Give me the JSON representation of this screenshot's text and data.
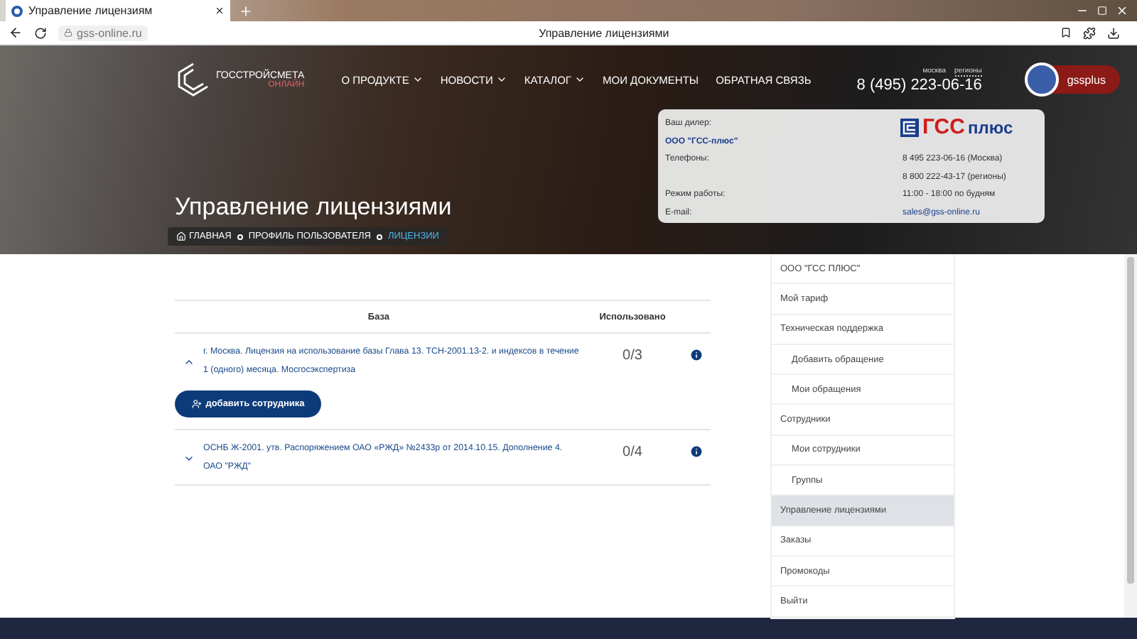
{
  "browser": {
    "tab_title": "Управление лицензиям",
    "address": "gss-online.ru",
    "page_title": "Управление лицензиями"
  },
  "header": {
    "logo": {
      "name": "ГОССТРОЙСМЕТА",
      "sub": "ОНЛАЙН"
    },
    "nav": [
      {
        "label": "О ПРОДУКТЕ",
        "has_menu": true
      },
      {
        "label": "НОВОСТИ",
        "has_menu": true
      },
      {
        "label": "КАТАЛОГ",
        "has_menu": true
      },
      {
        "label": "МОИ ДОКУМЕНТЫ",
        "has_menu": false
      },
      {
        "label": "ОБРАТНАЯ СВЯЗЬ",
        "has_menu": false
      }
    ],
    "phone": {
      "regions": [
        {
          "label": "москва",
          "selected": true
        },
        {
          "label": "регионы",
          "selected": false
        }
      ],
      "number": "8 (495) 223-06-16"
    },
    "user": "gssplus"
  },
  "dealer": {
    "logo": {
      "part1": "ГСС",
      "part2": "плюс"
    },
    "rows": [
      {
        "label": "Ваш дилер:",
        "value": ""
      },
      {
        "label": "ООО \"ГСС-плюс\"",
        "kind": "name"
      },
      {
        "label": "Телефоны:",
        "value": "8 495 223-06-16 (Москва)"
      },
      {
        "label": "",
        "value": "8 800 222-43-17 (регионы)"
      },
      {
        "label": "Режим работы:",
        "value": "11:00 - 18:00 по будням"
      },
      {
        "label": "E-mail:",
        "value": "sales@gss-online.ru",
        "kind": "link"
      }
    ]
  },
  "page_title": "Управление лицензиями",
  "breadcrumbs": [
    {
      "label": "ГЛАВНАЯ",
      "selected": false
    },
    {
      "label": "ПРОФИЛЬ ПОЛЬЗОВАТЕЛЯ",
      "selected": false
    },
    {
      "label": "ЛИЦЕНЗИИ",
      "selected": true
    }
  ],
  "table": {
    "columns": [
      "База",
      "Использовано"
    ],
    "rows": [
      {
        "name": "г. Москва. Лицензия на использование базы Глава 13. ТСН-2001.13-2. и индексов в течение 1 (одного) месяца. Мосгосэкспертиза",
        "used": "0/3",
        "expanded": true,
        "action": "добавить сотрудника"
      },
      {
        "name": "ОСНБ Ж-2001. утв. Распоряжением ОАО «РЖД» №2433р от 2014.10.15. Дополнение 4. ОАО \"РЖД\"",
        "used": "0/4",
        "expanded": false
      }
    ]
  },
  "sidebar": {
    "items": [
      {
        "label": "ООО \"ГСС ПЛЮС\"",
        "selected": false
      },
      {
        "label": "Мой тариф",
        "selected": false
      },
      {
        "label": "Техническая поддержка",
        "selected": false,
        "children": [
          {
            "label": "Добавить обращение",
            "selected": false
          },
          {
            "label": "Мои обращения",
            "selected": false
          }
        ]
      },
      {
        "label": "Сотрудники",
        "selected": false,
        "children": [
          {
            "label": "Мои сотрудники",
            "selected": false
          },
          {
            "label": "Группы",
            "selected": false
          }
        ]
      },
      {
        "label": "Управление лицензиями",
        "selected": true
      },
      {
        "label": "Заказы",
        "selected": false
      },
      {
        "label": "Промокоды",
        "selected": false
      },
      {
        "label": "Выйти",
        "selected": false
      }
    ]
  }
}
